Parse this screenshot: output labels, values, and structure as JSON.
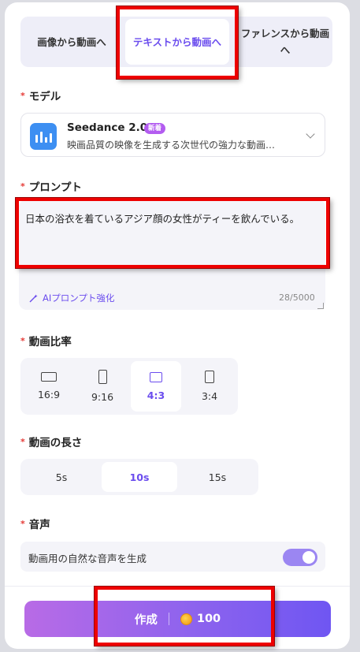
{
  "tabs": [
    {
      "label": "画像から動画へ"
    },
    {
      "label": "テキストから動画へ"
    },
    {
      "label": "ファレンスから動画へ"
    }
  ],
  "model": {
    "section_label": "モデル",
    "name": "Seedance 2.0",
    "badge": "新着",
    "description": "映画品質の映像を生成する次世代の強力な動画…"
  },
  "prompt": {
    "section_label": "プロンプト",
    "text": "日本の浴衣を着ているアジア顔の女性がティーを飲んでいる。",
    "enhance_label": "AIプロンプト強化",
    "counter": "28/5000"
  },
  "aspect": {
    "section_label": "動画比率",
    "options": [
      "16:9",
      "9:16",
      "4:3",
      "3:4"
    ],
    "selected": "4:3"
  },
  "duration": {
    "section_label": "動画の長さ",
    "options": [
      "5s",
      "10s",
      "15s"
    ],
    "selected": "10s"
  },
  "audio": {
    "section_label": "音声",
    "toggle_label": "動画用の自然な音声を生成",
    "enabled": true
  },
  "create": {
    "label": "作成",
    "cost": "100"
  },
  "colors": {
    "accent": "#6b4dee",
    "highlight": "#e00000"
  }
}
